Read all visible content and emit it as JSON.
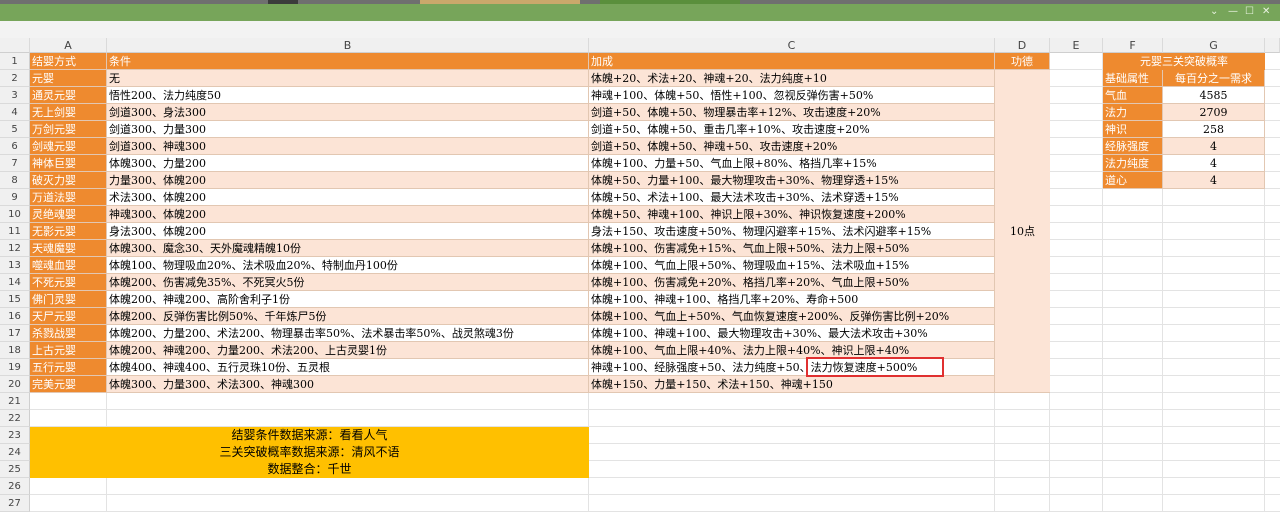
{
  "window": {
    "controls": [
      "⌄",
      "—",
      "☐",
      "✕"
    ]
  },
  "columns": [
    "A",
    "B",
    "C",
    "D",
    "E",
    "F",
    "G"
  ],
  "rows": [
    "1",
    "2",
    "3",
    "4",
    "5",
    "6",
    "7",
    "8",
    "9",
    "10",
    "11",
    "12",
    "13",
    "14",
    "15",
    "16",
    "17",
    "18",
    "19",
    "20",
    "21",
    "22",
    "23",
    "24",
    "25",
    "26",
    "27"
  ],
  "headers": {
    "a": "结婴方式",
    "b": "条件",
    "c": "加成",
    "d": "功德"
  },
  "merit": "10点",
  "table": [
    {
      "a": "元婴",
      "b": "无",
      "c": "体魄+20、术法+20、神魂+20、法力纯度+10"
    },
    {
      "a": "通灵元婴",
      "b": "悟性200、法力纯度50",
      "c": "神魂+100、体魄+50、悟性+100、忽视反弹伤害+50%"
    },
    {
      "a": "无上剑婴",
      "b": "剑道300、身法300",
      "c": "剑道+50、体魄+50、物理暴击率+12%、攻击速度+20%"
    },
    {
      "a": "万剑元婴",
      "b": "剑道300、力量300",
      "c": "剑道+50、体魄+50、重击几率+10%、攻击速度+20%"
    },
    {
      "a": "剑魂元婴",
      "b": "剑道300、神魂300",
      "c": "剑道+50、体魄+50、神魂+50、攻击速度+20%"
    },
    {
      "a": "神体巨婴",
      "b": "体魄300、力量200",
      "c": "体魄+100、力量+50、气血上限+80%、格挡几率+15%"
    },
    {
      "a": "破灭力婴",
      "b": "力量300、体魄200",
      "c": "体魄+50、力量+100、最大物理攻击+30%、物理穿透+15%"
    },
    {
      "a": "万道法婴",
      "b": "术法300、体魄200",
      "c": "体魄+50、术法+100、最大法术攻击+30%、法术穿透+15%"
    },
    {
      "a": "灵绝魂婴",
      "b": "神魂300、体魄200",
      "c": "体魄+50、神魂+100、神识上限+30%、神识恢复速度+200%"
    },
    {
      "a": "无影元婴",
      "b": "身法300、体魄200",
      "c": "身法+150、攻击速度+50%、物理闪避率+15%、法术闪避率+15%"
    },
    {
      "a": "天魂魔婴",
      "b": "体魄300、魔念30、天外魔魂精魄10份",
      "c": "体魄+100、伤害减免+15%、气血上限+50%、法力上限+50%"
    },
    {
      "a": "噬魂血婴",
      "b": "体魄100、物理吸血20%、法术吸血20%、特制血丹100份",
      "c": "体魄+100、气血上限+50%、物理吸血+15%、法术吸血+15%"
    },
    {
      "a": "不死元婴",
      "b": "体魄200、伤害减免35%、不死冥火5份",
      "c": "体魄+100、伤害减免+20%、格挡几率+20%、气血上限+50%"
    },
    {
      "a": "佛门灵婴",
      "b": "体魄200、神魂200、高阶舍利子1份",
      "c": "体魄+100、神魂+100、格挡几率+20%、寿命+500"
    },
    {
      "a": "天尸元婴",
      "b": "体魄200、反弹伤害比例50%、千年炼尸5份",
      "c": "体魄+100、气血上+50%、气血恢复速度+200%、反弹伤害比例+20%"
    },
    {
      "a": "杀戮战婴",
      "b": "体魄200、力量200、术法200、物理暴击率50%、法术暴击率50%、战灵煞魂3份",
      "c": "体魄+100、神魂+100、最大物理攻击+30%、最大法术攻击+30%"
    },
    {
      "a": "上古元婴",
      "b": "体魄200、神魂200、力量200、术法200、上古灵婴1份",
      "c": "体魄+100、气血上限+40%、法力上限+40%、神识上限+40%"
    },
    {
      "a": "五行元婴",
      "b": "体魄400、神魂400、五行灵珠10份、五灵根",
      "c": "神魂+100、经脉强度+50、法力纯度+50、法力恢复速度+500%"
    },
    {
      "a": "完美元婴",
      "b": "体魄300、力量300、术法300、神魂300",
      "c": "体魄+150、力量+150、术法+150、神魂+150"
    }
  ],
  "side": {
    "title": "元婴三关突破概率",
    "col1": "基础属性",
    "col2": "每百分之一需求",
    "rows": [
      {
        "k": "气血",
        "v": "4585"
      },
      {
        "k": "法力",
        "v": "2709"
      },
      {
        "k": "神识",
        "v": "258"
      },
      {
        "k": "经脉强度",
        "v": "4"
      },
      {
        "k": "法力纯度",
        "v": "4"
      },
      {
        "k": "道心",
        "v": "4"
      }
    ]
  },
  "notes": [
    "结婴条件数据来源：看看人气",
    "三关突破概率数据来源：清风不语",
    "数据整合：千世"
  ],
  "colors": {
    "header_orange": "#ee8a2f",
    "row_peach": "#fce4d6",
    "note_gold": "#ffc000",
    "highlight_red": "#e03030",
    "title_green": "#77a55a"
  }
}
